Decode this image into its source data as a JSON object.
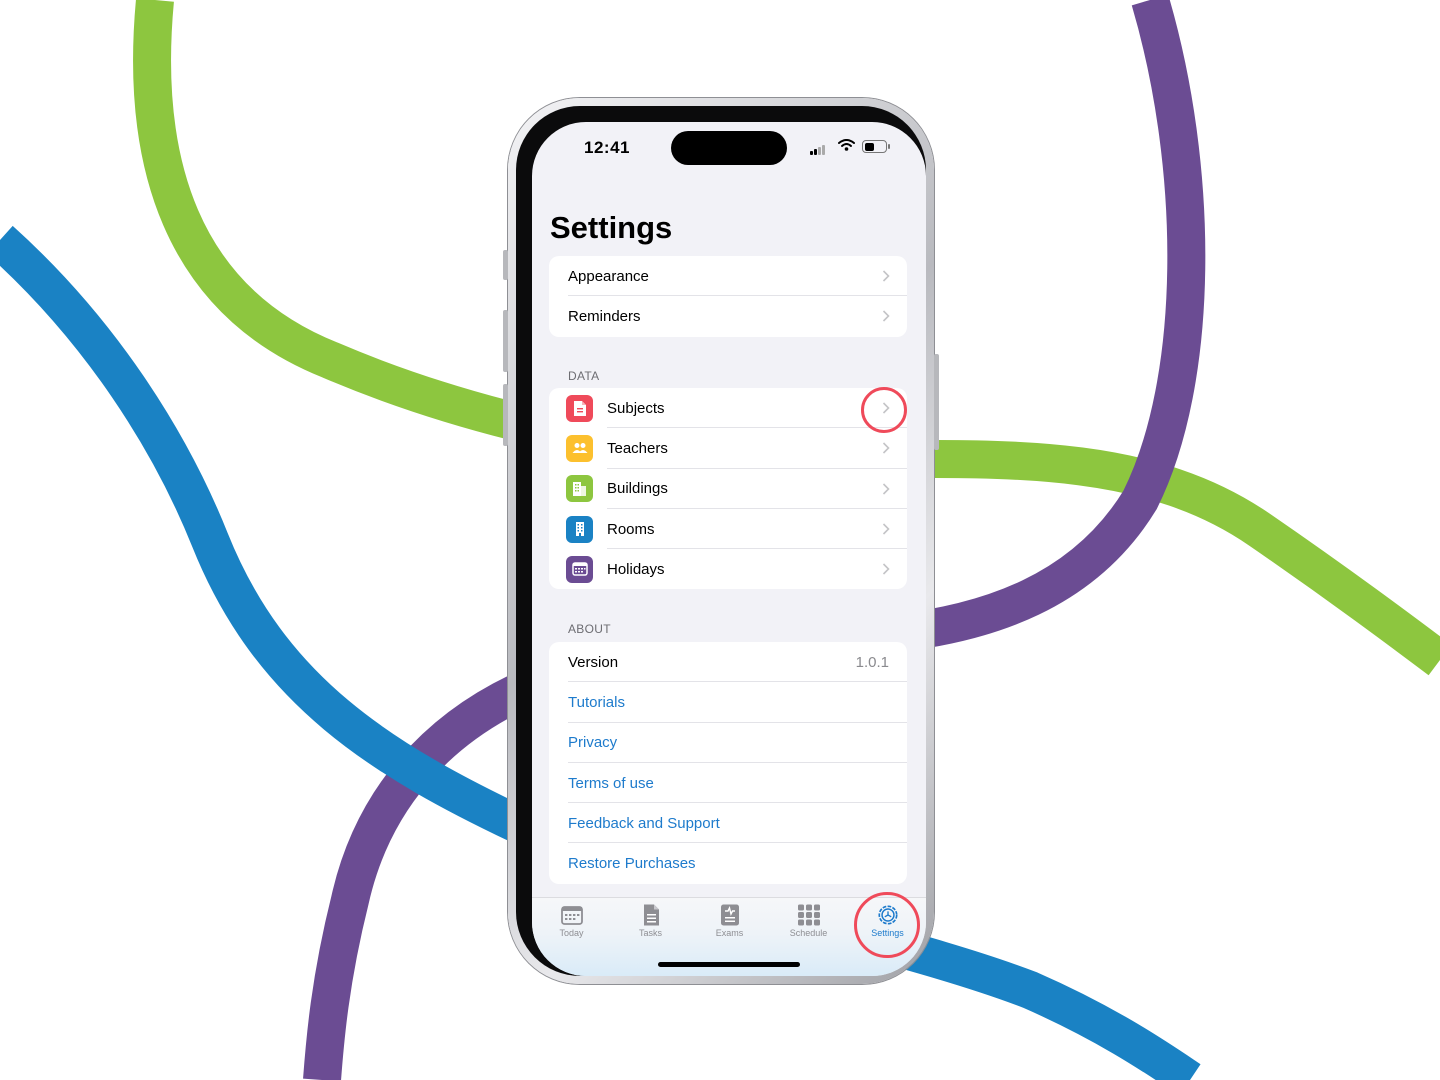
{
  "status_bar": {
    "time": "12:41"
  },
  "page_title": "Settings",
  "general_items": [
    {
      "label": "Appearance"
    },
    {
      "label": "Reminders"
    }
  ],
  "data_section": {
    "header": "DATA",
    "items": [
      {
        "label": "Subjects",
        "icon": "document-icon",
        "color": "#ef4a5a"
      },
      {
        "label": "Teachers",
        "icon": "people-icon",
        "color": "#fcc02e"
      },
      {
        "label": "Buildings",
        "icon": "building-icon",
        "color": "#8dc63f"
      },
      {
        "label": "Rooms",
        "icon": "door-icon",
        "color": "#1a82c4"
      },
      {
        "label": "Holidays",
        "icon": "calendar-icon",
        "color": "#6b4c93"
      }
    ]
  },
  "about_section": {
    "header": "ABOUT",
    "version_label": "Version",
    "version_value": "1.0.1",
    "links": [
      "Tutorials",
      "Privacy",
      "Terms of use",
      "Feedback and Support",
      "Restore Purchases"
    ]
  },
  "tab_bar": {
    "tabs": [
      {
        "label": "Today",
        "icon": "calendar-grid-icon"
      },
      {
        "label": "Tasks",
        "icon": "task-document-icon"
      },
      {
        "label": "Exams",
        "icon": "exam-document-icon"
      },
      {
        "label": "Schedule",
        "icon": "grid-icon"
      },
      {
        "label": "Settings",
        "icon": "gear-icon"
      }
    ],
    "active": "Settings"
  },
  "colors": {
    "accent": "#1e7bcc",
    "highlight_ring": "#ef4a5a",
    "background_green": "#8dc63f",
    "background_purple": "#6b4c93",
    "background_blue": "#1a82c4"
  }
}
